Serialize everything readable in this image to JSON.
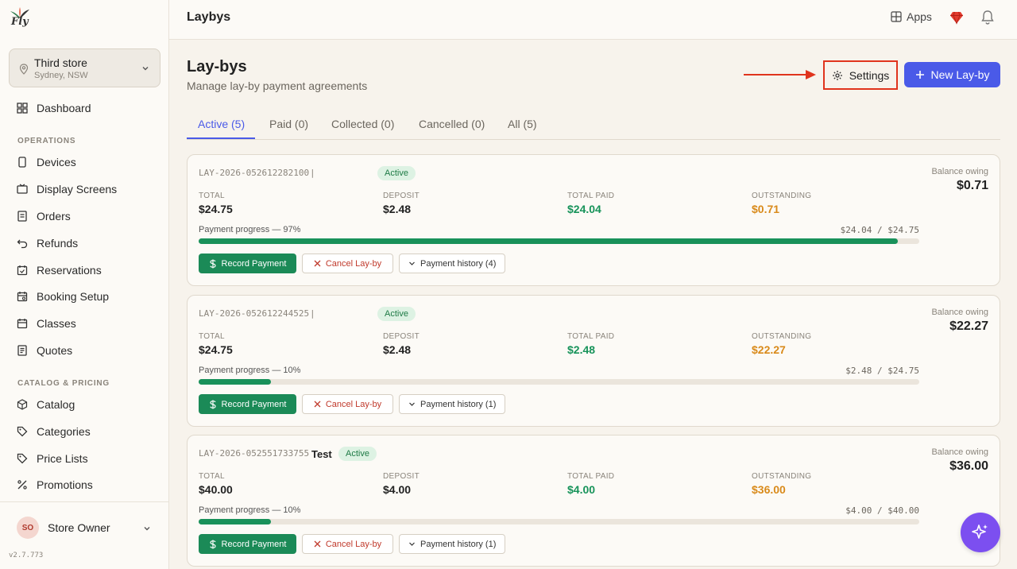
{
  "brand": {
    "logo_text": "Fly"
  },
  "store": {
    "name": "Third store",
    "location": "Sydney, NSW"
  },
  "nav": {
    "dashboard": "Dashboard",
    "operations_header": "OPERATIONS",
    "operations": [
      "Devices",
      "Display Screens",
      "Orders",
      "Refunds",
      "Reservations",
      "Booking Setup",
      "Classes",
      "Quotes"
    ],
    "catalog_header": "CATALOG & PRICING",
    "catalog": [
      "Catalog",
      "Categories",
      "Price Lists",
      "Promotions"
    ]
  },
  "user": {
    "initials": "SO",
    "name": "Store Owner",
    "version": "v2.7.773"
  },
  "topbar": {
    "title": "Laybys",
    "apps_label": "Apps"
  },
  "header": {
    "title": "Lay-bys",
    "subtitle": "Manage lay-by payment agreements",
    "settings_label": "Settings",
    "new_label": "New Lay-by"
  },
  "tabs": [
    "Active (5)",
    "Paid (0)",
    "Collected (0)",
    "Cancelled (0)",
    "All (5)"
  ],
  "labels": {
    "total": "TOTAL",
    "deposit": "DEPOSIT",
    "total_paid": "TOTAL PAID",
    "outstanding": "OUTSTANDING",
    "balance_owing": "Balance owing",
    "record_payment": "Record Payment",
    "cancel_layby": "Cancel Lay-by"
  },
  "laybys": [
    {
      "ref": "LAY-2026-052612282100",
      "separator": "|",
      "label": "",
      "status": "Active",
      "balance": "$0.71",
      "total": "$24.75",
      "deposit": "$2.48",
      "paid": "$24.04",
      "outstanding": "$0.71",
      "progress_text": "Payment progress — 97%",
      "progress_ratio": "$24.04 / $24.75",
      "progress_pct": 97,
      "history": "Payment history (4)"
    },
    {
      "ref": "LAY-2026-052612244525",
      "separator": "|",
      "label": "",
      "status": "Active",
      "balance": "$22.27",
      "total": "$24.75",
      "deposit": "$2.48",
      "paid": "$2.48",
      "outstanding": "$22.27",
      "progress_text": "Payment progress — 10%",
      "progress_ratio": "$2.48 / $24.75",
      "progress_pct": 10,
      "history": "Payment history (1)"
    },
    {
      "ref": "LAY-2026-052551733755",
      "separator": "",
      "label": "Test",
      "status": "Active",
      "balance": "$36.00",
      "total": "$40.00",
      "deposit": "$4.00",
      "paid": "$4.00",
      "outstanding": "$36.00",
      "progress_text": "Payment progress — 10%",
      "progress_ratio": "$4.00 / $40.00",
      "progress_pct": 10,
      "history": "Payment history (1)"
    }
  ],
  "colors": {
    "accent": "#4a5ae8",
    "success": "#1b8a57",
    "warning": "#d98a1a",
    "danger": "#c0392b",
    "highlight": "#e0341d"
  },
  "icons": {
    "settings": "gear-icon",
    "new": "plus-icon",
    "apps": "grid-icon",
    "premium": "gem-icon",
    "notifications": "bell-icon",
    "assistant": "sparkle-icon"
  }
}
